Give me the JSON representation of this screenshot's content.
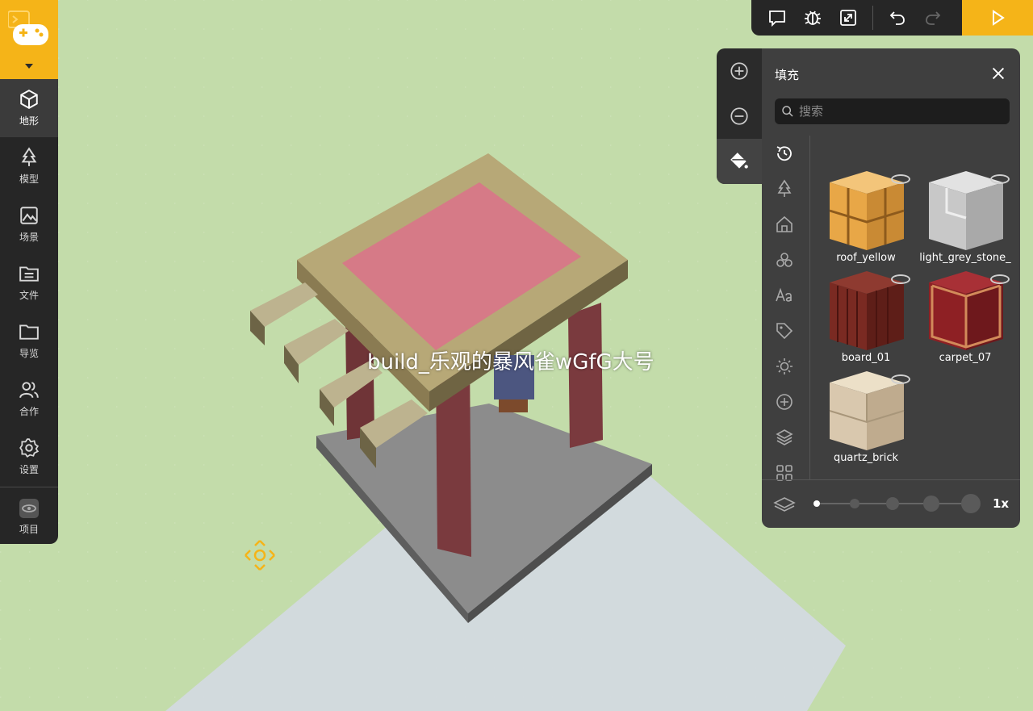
{
  "sidebar": {
    "items": [
      {
        "label": "地形",
        "icon": "cube-icon",
        "active": true
      },
      {
        "label": "模型",
        "icon": "tree-icon",
        "active": false
      },
      {
        "label": "场景",
        "icon": "image-icon",
        "active": false
      },
      {
        "label": "文件",
        "icon": "folder-list-icon",
        "active": false
      },
      {
        "label": "导览",
        "icon": "folder-icon",
        "active": false
      },
      {
        "label": "合作",
        "icon": "users-icon",
        "active": false
      },
      {
        "label": "设置",
        "icon": "gear-icon",
        "active": false
      }
    ],
    "project_label": "项目"
  },
  "toolbar": {
    "buttons": [
      "chat-icon",
      "bug-icon",
      "expand-icon",
      "undo-icon",
      "redo-icon"
    ],
    "play": "play-icon",
    "accent": "#f5b418"
  },
  "tools": [
    "zoom-in-icon",
    "zoom-out-icon",
    "paint-bucket-icon"
  ],
  "panel": {
    "title": "填充",
    "search_placeholder": "搜索",
    "categories": [
      "recent-icon",
      "tree-icon",
      "house-icon",
      "blocks-icon",
      "text-icon",
      "tag-icon",
      "sun-icon",
      "add-icon",
      "layers-icon",
      "grid-icon"
    ],
    "materials": [
      {
        "name": "roof_yellow",
        "color": "#e8a747"
      },
      {
        "name": "light_grey_stone_",
        "color": "#c8c8c8"
      },
      {
        "name": "board_01",
        "color": "#7a2a22"
      },
      {
        "name": "carpet_07",
        "color": "#8e2024"
      },
      {
        "name": "quartz_brick",
        "color": "#d9c8ae"
      }
    ],
    "brush_size_levels": 5,
    "brush_size_selected": 1,
    "zoom_label": "1x"
  },
  "scene": {
    "overlay_label": "build_乐观的暴风雀wGfG大号"
  }
}
